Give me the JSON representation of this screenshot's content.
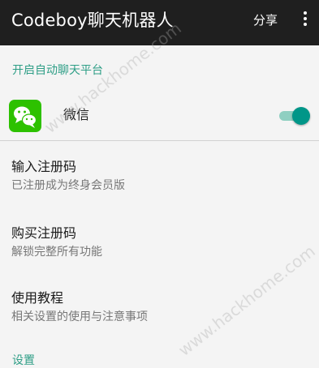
{
  "appbar": {
    "title": "Codeboy聊天机器人",
    "share_label": "分享",
    "more_icon": "more-vertical-icon"
  },
  "section_auto_chat": {
    "header": "开启自动聊天平台",
    "wechat": {
      "label": "微信",
      "icon": "wechat-icon",
      "enabled": true,
      "accent_color": "#009688"
    }
  },
  "items": [
    {
      "title": "输入注册码",
      "subtitle": "已注册成为终身会员版"
    },
    {
      "title": "购买注册码",
      "subtitle": "解锁完整所有功能"
    },
    {
      "title": "使用教程",
      "subtitle": "相关设置的使用与注意事项"
    }
  ],
  "section_settings": {
    "header": "设置"
  },
  "watermarks": [
    "www.hackhome.com",
    "www.hackhome.com"
  ],
  "colors": {
    "appbar_bg": "#1f1f1f",
    "section_header": "#2e9e86",
    "wechat_green": "#2dc100"
  }
}
